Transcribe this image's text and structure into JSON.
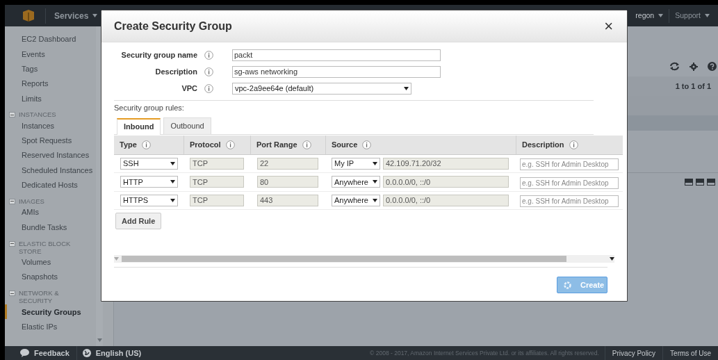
{
  "top_bar": {
    "services": "Services",
    "region": "regon",
    "support": "Support"
  },
  "sidebar": {
    "items": [
      {
        "kind": "link",
        "label": "EC2 Dashboard",
        "selected": false
      },
      {
        "kind": "link",
        "label": "Events",
        "selected": false
      },
      {
        "kind": "link",
        "label": "Tags",
        "selected": false
      },
      {
        "kind": "link",
        "label": "Reports",
        "selected": false
      },
      {
        "kind": "link",
        "label": "Limits",
        "selected": false
      },
      {
        "kind": "section",
        "label": "INSTANCES",
        "expanded": true
      },
      {
        "kind": "link",
        "label": "Instances",
        "selected": false
      },
      {
        "kind": "link",
        "label": "Spot Requests",
        "selected": false
      },
      {
        "kind": "link",
        "label": "Reserved Instances",
        "selected": false
      },
      {
        "kind": "link",
        "label": "Scheduled Instances",
        "selected": false
      },
      {
        "kind": "link",
        "label": "Dedicated Hosts",
        "selected": false
      },
      {
        "kind": "section",
        "label": "IMAGES",
        "expanded": true
      },
      {
        "kind": "link",
        "label": "AMIs",
        "selected": false
      },
      {
        "kind": "link",
        "label": "Bundle Tasks",
        "selected": false
      },
      {
        "kind": "section",
        "label": "ELASTIC BLOCK STORE",
        "expanded": true
      },
      {
        "kind": "link",
        "label": "Volumes",
        "selected": false
      },
      {
        "kind": "link",
        "label": "Snapshots",
        "selected": false
      },
      {
        "kind": "section",
        "label": "NETWORK & SECURITY",
        "expanded": true
      },
      {
        "kind": "link",
        "label": "Security Groups",
        "selected": true
      },
      {
        "kind": "link",
        "label": "Elastic IPs",
        "selected": false
      }
    ]
  },
  "main": {
    "pager": "1 to 1 of 1"
  },
  "dialog": {
    "title": "Create Security Group",
    "close": "×",
    "fields": [
      {
        "kind": "text",
        "label": "Security group name",
        "value": "packt"
      },
      {
        "kind": "text",
        "label": "Description",
        "value": "sg-aws networking"
      },
      {
        "kind": "select",
        "label": "VPC",
        "value": "vpc-2a9ee64e (default)"
      }
    ],
    "rules_label": "Security group rules:",
    "tabs": [
      {
        "label": "Inbound",
        "selected": true
      },
      {
        "label": "Outbound",
        "selected": false
      }
    ],
    "columns": [
      "Type",
      "Protocol",
      "Port Range",
      "Source",
      "Description"
    ],
    "rows": [
      {
        "type": "SSH",
        "protocol": "TCP",
        "port_range": "22",
        "source": "My IP",
        "cidr": "42.109.71.20/32",
        "description_placeholder": "e.g. SSH for Admin Desktop"
      },
      {
        "type": "HTTP",
        "protocol": "TCP",
        "port_range": "80",
        "source": "Anywhere",
        "cidr": "0.0.0.0/0, ::/0",
        "description_placeholder": "e.g. SSH for Admin Desktop"
      },
      {
        "type": "HTTPS",
        "protocol": "TCP",
        "port_range": "443",
        "source": "Anywhere",
        "cidr": "0.0.0.0/0, ::/0",
        "description_placeholder": "e.g. SSH for Admin Desktop"
      }
    ],
    "add_rule": "Add Rule",
    "create": {
      "label": "Create",
      "loading": true
    }
  },
  "footer": {
    "feedback": "Feedback",
    "language": "English (US)",
    "copyright": "© 2008 - 2017, Amazon Internet Services Private Ltd. or its affiliates. All rights reserved.",
    "links": [
      "Privacy Policy",
      "Terms of Use"
    ]
  }
}
